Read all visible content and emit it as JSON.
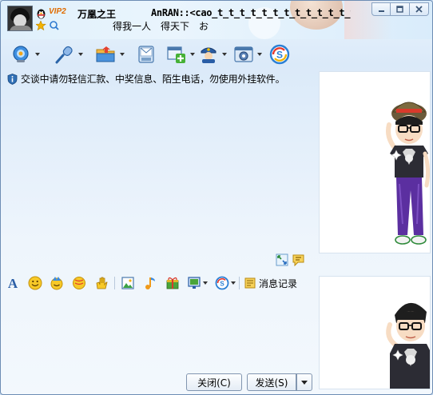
{
  "header": {
    "vip_badge": "VIP2",
    "nickname": "万凰之王",
    "remark": "AnRAN::<cao_t_t_t_t_t_t_t_t_t_t_t_t_t_t_t_t_t_...",
    "signature": "得我一人　得天下　お"
  },
  "toolbar": {
    "items": [
      "video-call-icon",
      "voice-call-icon",
      "send-file-icon",
      "send-sms-icon",
      "create-group-icon",
      "app-icon",
      "settings-icon",
      "soso-icon"
    ]
  },
  "chat": {
    "notice": "交谈中请勿轻信汇款、中奖信息、陌生电话，勿使用外挂软件。"
  },
  "input_toolbar": {
    "history_label": "消息记录"
  },
  "buttons": {
    "close_label": "关闭(C)",
    "send_label": "发送(S)"
  },
  "colors": {
    "accent": "#2f6fb5",
    "vip": "#e06c00"
  }
}
